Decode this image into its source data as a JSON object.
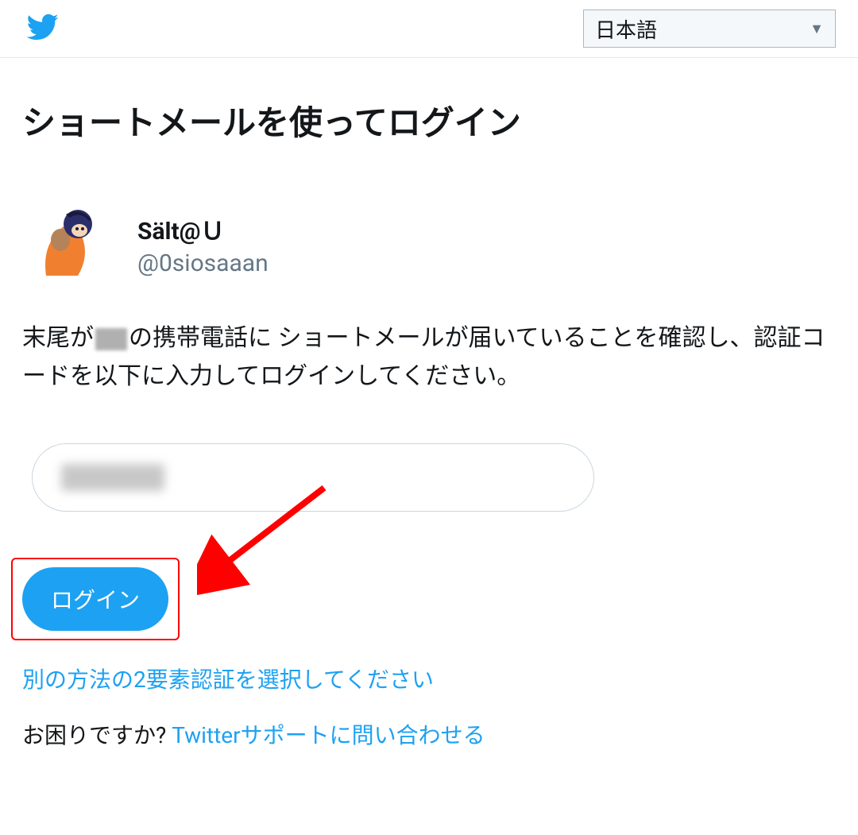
{
  "header": {
    "language": "日本語"
  },
  "page": {
    "title": "ショートメールを使ってログイン"
  },
  "user": {
    "display_name": "Sält@Ｕ",
    "handle": "@0siosaaan"
  },
  "instruction": {
    "prefix": "末尾が",
    "suffix": "の携帯電話に ショートメールが届いていることを確認し、認証コードを以下に入力してログインしてください。"
  },
  "actions": {
    "login_label": "ログイン",
    "alt_method_label": "別の方法の2要素認証を選択してください"
  },
  "help": {
    "prompt": "お困りですか? ",
    "link_label": "Twitterサポートに問い合わせる"
  }
}
